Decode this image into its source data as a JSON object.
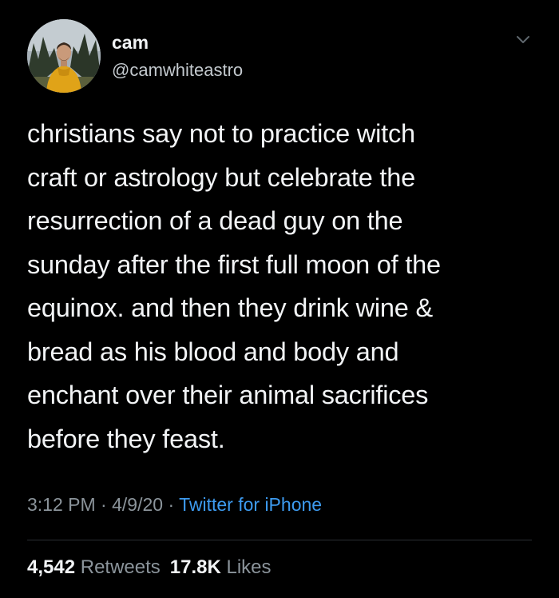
{
  "user": {
    "name": "cam",
    "handle": "@camwhiteastro"
  },
  "tweet": {
    "lines": [
      "christians say not to practice witch",
      "craft or astrology but celebrate the",
      "resurrection of a dead guy on the",
      "sunday after the first full moon of the",
      "equinox. and then they drink wine &",
      "bread as his blood and body and",
      "enchant over their animal sacrifices",
      "before they feast."
    ]
  },
  "meta": {
    "time": "3:12 PM",
    "sep1": " · ",
    "date": "4/9/20",
    "sep2": " · ",
    "source": "Twitter for iPhone"
  },
  "stats": {
    "retweets_count": "4,542",
    "retweets_label": "Retweets",
    "likes_count": "17.8K",
    "likes_label": "Likes"
  },
  "icons": {
    "menu": "chevron-down-icon"
  },
  "colors": {
    "background": "#000000",
    "link": "#3d9bf0",
    "secondary_text": "#8b949b"
  }
}
